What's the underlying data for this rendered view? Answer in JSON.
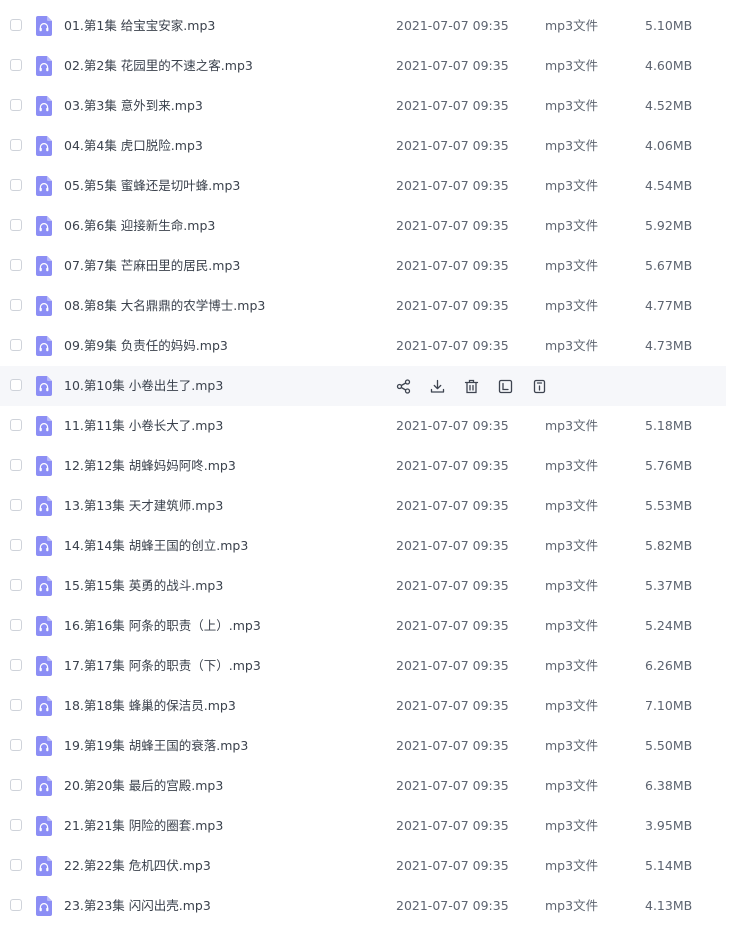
{
  "colors": {
    "accent": "#8c8ef5",
    "row_hover_bg": "#f6f7fa",
    "text": "#3a414c",
    "muted_text": "#5d6470"
  },
  "icons": {
    "file": "audio-file-icon",
    "actions": [
      "share-icon",
      "download-icon",
      "delete-icon",
      "rename-icon",
      "copy-icon"
    ]
  },
  "files": [
    {
      "name": "01.第1集 给宝宝安家.mp3",
      "date": "2021-07-07 09:35",
      "type": "mp3文件",
      "size": "5.10MB"
    },
    {
      "name": "02.第2集 花园里的不速之客.mp3",
      "date": "2021-07-07 09:35",
      "type": "mp3文件",
      "size": "4.60MB"
    },
    {
      "name": "03.第3集 意外到来.mp3",
      "date": "2021-07-07 09:35",
      "type": "mp3文件",
      "size": "4.52MB"
    },
    {
      "name": "04.第4集 虎口脱险.mp3",
      "date": "2021-07-07 09:35",
      "type": "mp3文件",
      "size": "4.06MB"
    },
    {
      "name": "05.第5集 蜜蜂还是切叶蜂.mp3",
      "date": "2021-07-07 09:35",
      "type": "mp3文件",
      "size": "4.54MB"
    },
    {
      "name": "06.第6集 迎接新生命.mp3",
      "date": "2021-07-07 09:35",
      "type": "mp3文件",
      "size": "5.92MB"
    },
    {
      "name": "07.第7集 芒麻田里的居民.mp3",
      "date": "2021-07-07 09:35",
      "type": "mp3文件",
      "size": "5.67MB"
    },
    {
      "name": "08.第8集 大名鼎鼎的农学博士.mp3",
      "date": "2021-07-07 09:35",
      "type": "mp3文件",
      "size": "4.77MB"
    },
    {
      "name": "09.第9集 负责任的妈妈.mp3",
      "date": "2021-07-07 09:35",
      "type": "mp3文件",
      "size": "4.73MB"
    },
    {
      "name": "10.第10集 小卷出生了.mp3",
      "date": "",
      "type": "",
      "size": "",
      "hovered": true
    },
    {
      "name": "11.第11集 小卷长大了.mp3",
      "date": "2021-07-07 09:35",
      "type": "mp3文件",
      "size": "5.18MB"
    },
    {
      "name": "12.第12集 胡蜂妈妈阿咚.mp3",
      "date": "2021-07-07 09:35",
      "type": "mp3文件",
      "size": "5.76MB"
    },
    {
      "name": "13.第13集 天才建筑师.mp3",
      "date": "2021-07-07 09:35",
      "type": "mp3文件",
      "size": "5.53MB"
    },
    {
      "name": "14.第14集 胡蜂王国的创立.mp3",
      "date": "2021-07-07 09:35",
      "type": "mp3文件",
      "size": "5.82MB"
    },
    {
      "name": "15.第15集 英勇的战斗.mp3",
      "date": "2021-07-07 09:35",
      "type": "mp3文件",
      "size": "5.37MB"
    },
    {
      "name": "16.第16集 阿条的职责（上）.mp3",
      "date": "2021-07-07 09:35",
      "type": "mp3文件",
      "size": "5.24MB"
    },
    {
      "name": "17.第17集 阿条的职责（下）.mp3",
      "date": "2021-07-07 09:35",
      "type": "mp3文件",
      "size": "6.26MB"
    },
    {
      "name": "18.第18集 蜂巢的保洁员.mp3",
      "date": "2021-07-07 09:35",
      "type": "mp3文件",
      "size": "7.10MB"
    },
    {
      "name": "19.第19集 胡蜂王国的衰落.mp3",
      "date": "2021-07-07 09:35",
      "type": "mp3文件",
      "size": "5.50MB"
    },
    {
      "name": "20.第20集 最后的宫殿.mp3",
      "date": "2021-07-07 09:35",
      "type": "mp3文件",
      "size": "6.38MB"
    },
    {
      "name": "21.第21集 阴险的圈套.mp3",
      "date": "2021-07-07 09:35",
      "type": "mp3文件",
      "size": "3.95MB"
    },
    {
      "name": "22.第22集 危机四伏.mp3",
      "date": "2021-07-07 09:35",
      "type": "mp3文件",
      "size": "5.14MB"
    },
    {
      "name": "23.第23集 闪闪出壳.mp3",
      "date": "2021-07-07 09:35",
      "type": "mp3文件",
      "size": "4.13MB"
    }
  ]
}
